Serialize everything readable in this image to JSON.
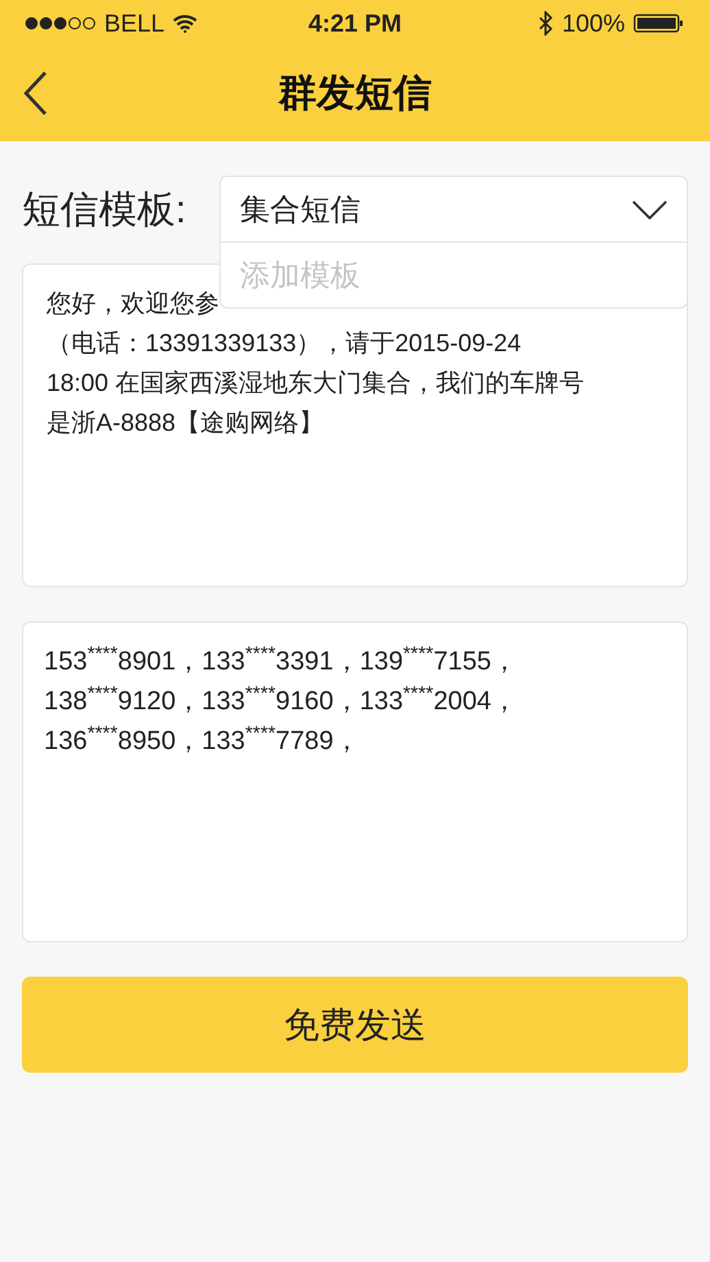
{
  "status_bar": {
    "carrier": "BELL",
    "time": "4:21 PM",
    "battery": "100%"
  },
  "header": {
    "title": "群发短信"
  },
  "template": {
    "label": "短信模板:",
    "value": "集合短信",
    "expanded": true,
    "options": [
      "添加模板"
    ]
  },
  "message": {
    "lines": [
      "您好，欢迎您参",
      "（电话：13391339133），请于2015-09-24",
      "18:00 在国家西溪湿地东大门集合，我们的车牌号",
      "是浙A-8888【途购网络】"
    ]
  },
  "recipients": {
    "lines": [
      "153$^{****}$8901，133$^{****}$3391，139$^{****}$7155，",
      "138$^{****}$9120，133$^{****}$9160，133$^{****}$2004，",
      "136$^{****}$8950，133$^{****}$7789，"
    ]
  },
  "send_button": "免费发送"
}
